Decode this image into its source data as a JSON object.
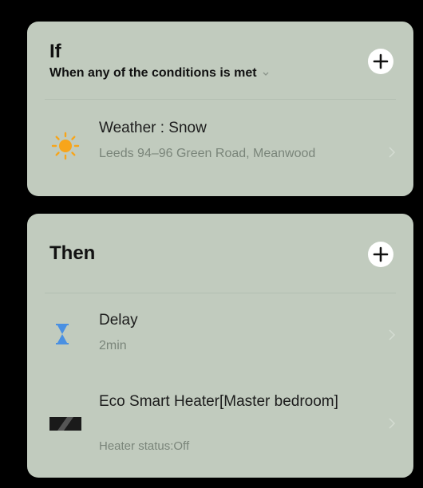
{
  "if_card": {
    "title": "If",
    "subtitle": "When any of the conditions is met",
    "add_icon": "plus-icon",
    "condition": {
      "icon": "sun-icon",
      "title": "Weather : Snow",
      "subtitle": "Leeds 94–96 Green Road, Meanwood"
    }
  },
  "then_card": {
    "title": "Then",
    "add_icon": "plus-icon",
    "actions": [
      {
        "icon": "hourglass-icon",
        "title": "Delay",
        "subtitle": "2min"
      },
      {
        "icon": "heater-icon",
        "title": "Eco Smart Heater[Master bedroom]",
        "subtitle": "Heater status:Off"
      }
    ]
  },
  "colors": {
    "card_background": "#c1cbbe",
    "page_background": "#000000",
    "sun": "#f7a51b",
    "hourglass": "#4a90e2",
    "secondary_text": "#7a857a"
  }
}
